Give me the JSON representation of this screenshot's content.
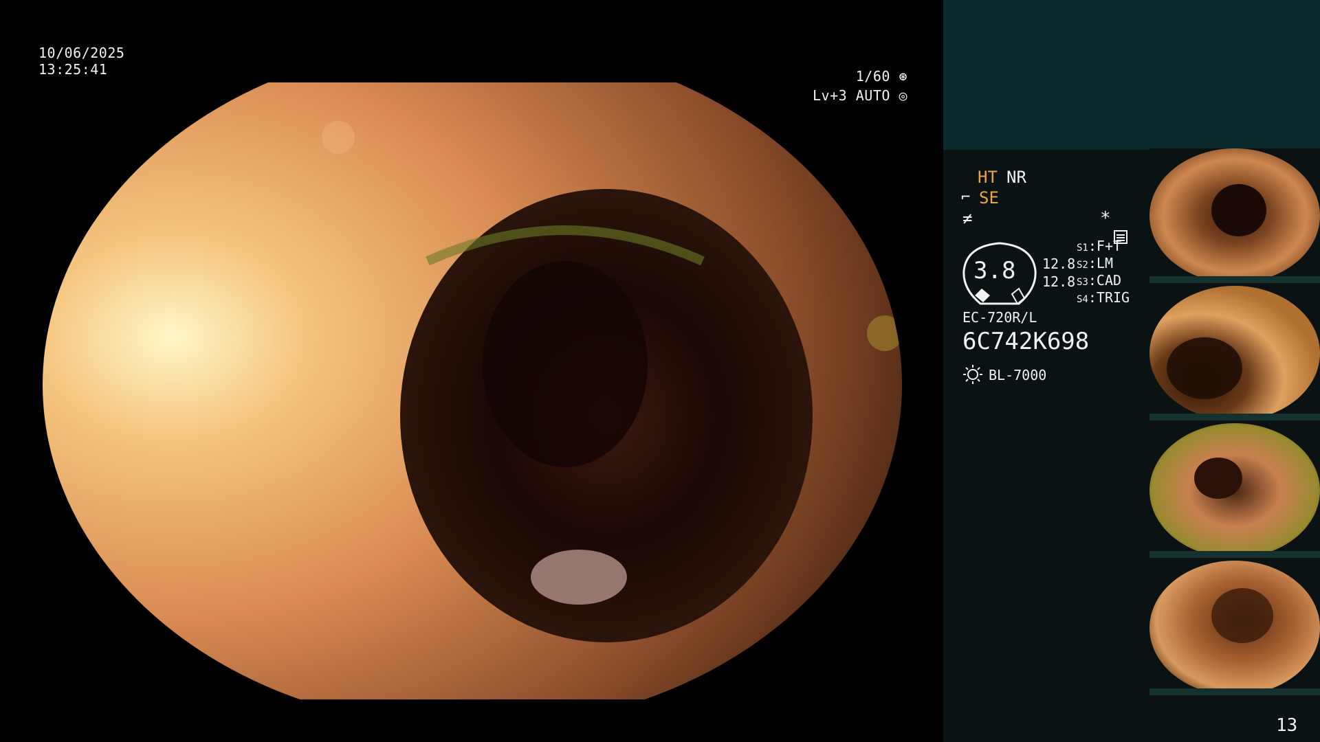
{
  "overlay": {
    "date": "10/06/2025",
    "time": "13:25:41",
    "shutter": "1/60",
    "level": "Lv+3",
    "mode": "AUTO"
  },
  "panel": {
    "ht": "HT",
    "nr": "NR",
    "se": "SE",
    "asterisk": "*",
    "gauge_value": "3.8",
    "value_top": "12.8",
    "value_bottom": "12.8",
    "switches": [
      {
        "key": "S1",
        "value": "F+T"
      },
      {
        "key": "S2",
        "value": "LM"
      },
      {
        "key": "S3",
        "value": "CAD"
      },
      {
        "key": "S4",
        "value": "TRIG"
      }
    ],
    "scope_model": "EC-720R/L",
    "serial": "6C742K698",
    "light_source": "BL-7000",
    "page_number": "13"
  },
  "colors": {
    "accent": "#f2a43a",
    "panel_bg": "#0a1213",
    "panel_header": "#0c2a2c"
  },
  "thumbnails": [
    {
      "name": "capture-1"
    },
    {
      "name": "capture-2"
    },
    {
      "name": "capture-3"
    },
    {
      "name": "capture-4"
    }
  ]
}
